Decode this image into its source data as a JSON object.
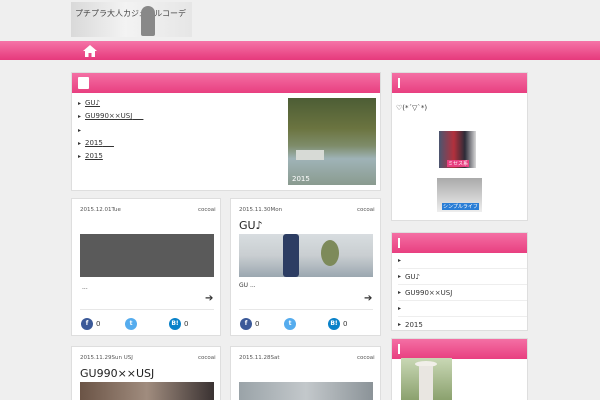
{
  "header": {
    "logo_text": "プチプラ大人カジュアルコーデ"
  },
  "nav": {
    "home_icon": "home-icon"
  },
  "featured": {
    "links": [
      "GU♪",
      "GU990××USJ",
      "",
      "2015",
      "2015"
    ],
    "image_caption": "2015"
  },
  "cards": [
    {
      "date": "2015.12.01Tue",
      "author": "cocoai",
      "title": "",
      "excerpt": "...",
      "fb": "0",
      "hb": "0"
    },
    {
      "date": "2015.11.30Mon",
      "author": "cocoai",
      "title": "GU♪",
      "excerpt": "GU ...",
      "fb": "0",
      "hb": "0"
    },
    {
      "date": "2015.11.29Sun USJ",
      "author": "cocoai",
      "title": "GU990××USJ"
    },
    {
      "date": "2015.11.28Sat",
      "author": "cocoai",
      "title": ""
    }
  ],
  "sidebar": {
    "profile_text": "♡(*´▽`*)",
    "banner1_label": "ミセス系",
    "banner2_label": "シンプルライフ",
    "recent_links": [
      "",
      "GU♪",
      "GU990××USJ",
      "",
      "2015"
    ]
  },
  "colors": {
    "accent": "#e83f80"
  }
}
